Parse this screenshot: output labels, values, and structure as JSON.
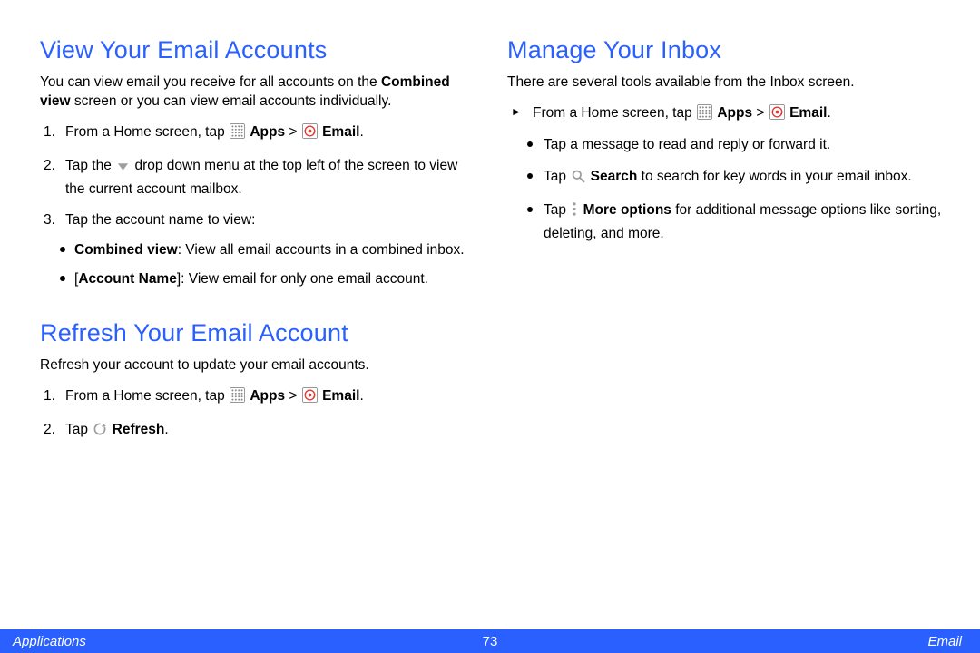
{
  "left": {
    "section1": {
      "heading": "View Your Email Accounts",
      "intro_parts": [
        "You can view email you receive for all accounts on the ",
        "Combined view",
        " screen or you can view email accounts individually."
      ],
      "step1_parts": [
        "From a Home screen, tap ",
        "APPS_ICON",
        " ",
        "Apps",
        " > ",
        "EMAIL_ICON",
        " ",
        "Email",
        "."
      ],
      "step2_parts": [
        "Tap the ",
        "DROPDOWN_ICON",
        " drop down menu at the top left of the screen to view the current account mailbox."
      ],
      "step3_lead": "Tap the account name to view:",
      "step3_b1_parts": [
        "Combined view",
        ": View all email accounts in a combined inbox."
      ],
      "step3_b2_parts": [
        "[",
        "Account Name",
        "]: View email for only one email account."
      ]
    },
    "section2": {
      "heading": "Refresh Your Email Account",
      "intro": "Refresh your account to update your email accounts.",
      "step1_parts": [
        "From a Home screen, tap ",
        "APPS_ICON",
        " ",
        "Apps",
        " > ",
        "EMAIL_ICON",
        " ",
        "Email",
        "."
      ],
      "step2_parts": [
        "Tap ",
        "REFRESH_ICON",
        " ",
        "Refresh",
        "."
      ]
    }
  },
  "right": {
    "section1": {
      "heading": "Manage Your Inbox",
      "intro": "There are several tools available from the Inbox screen.",
      "lead_parts": [
        "From a Home screen, tap ",
        "APPS_ICON",
        " ",
        "Apps",
        " > ",
        "EMAIL_ICON",
        " ",
        "Email",
        "."
      ],
      "b1": "Tap a message to read and reply or forward it.",
      "b2_parts": [
        "Tap ",
        "SEARCH_ICON",
        " ",
        "Search",
        " to search for key words in your email inbox."
      ],
      "b3_parts": [
        "Tap ",
        "MORE_ICON",
        " ",
        "More options",
        " for additional message options like sorting, deleting, and more."
      ]
    }
  },
  "footer": {
    "left": "Applications",
    "center": "73",
    "right": "Email"
  }
}
